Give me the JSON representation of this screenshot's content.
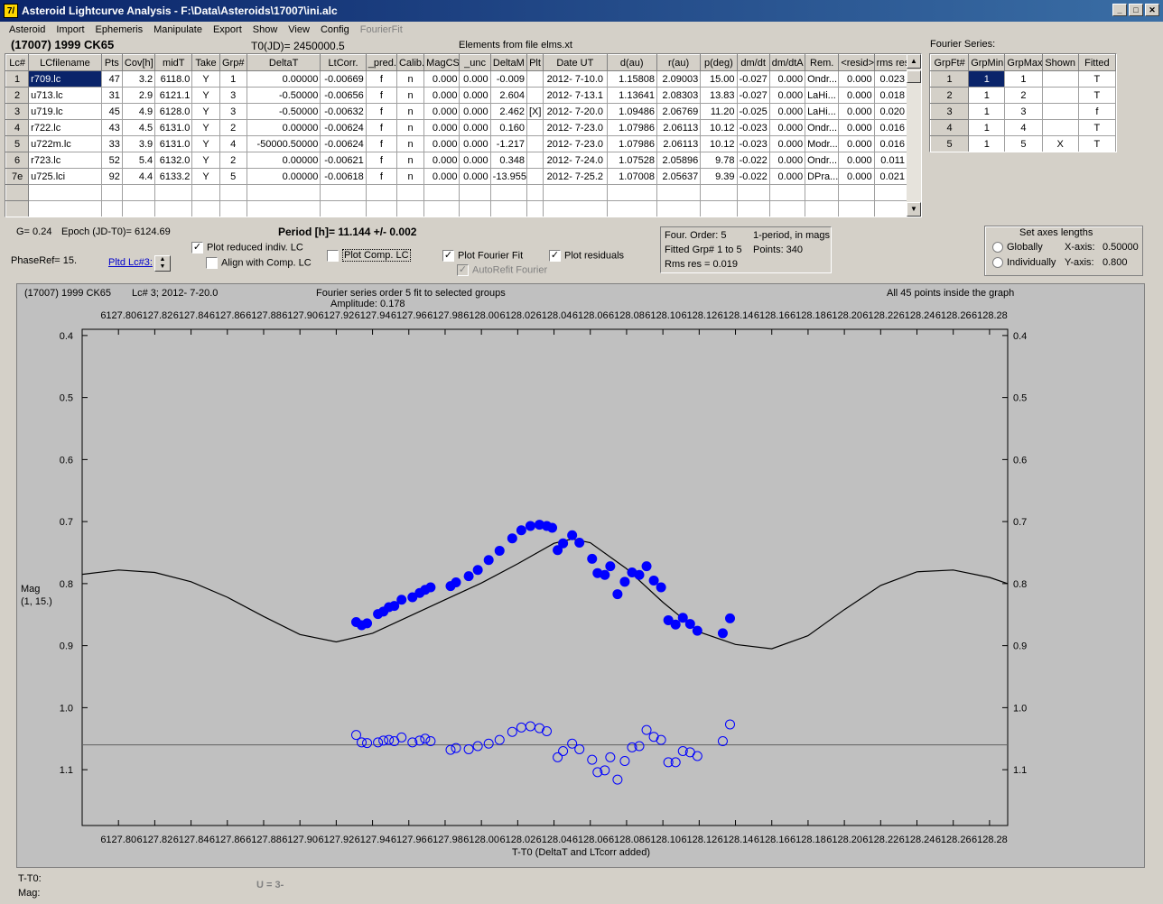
{
  "window": {
    "title": "Asteroid Lightcurve Analysis - F:\\Data\\Asteroids\\17007\\ini.alc",
    "icon_text": "7/"
  },
  "menu": [
    "Asteroid",
    "Import",
    "Ephemeris",
    "Manipulate",
    "Export",
    "Show",
    "View",
    "Config",
    "FourierFit"
  ],
  "header": {
    "asteroid": "(17007) 1999 CK65",
    "t0": "T0(JD)= 2450000.5",
    "elements": "Elements from file elms.xt"
  },
  "lc_table": {
    "columns": [
      "Lc#",
      "LCfilename",
      "Pts",
      "Cov[h]",
      "midT",
      "Take",
      "Grp#",
      "DeltaT",
      "LtCorr.",
      "_pred.",
      "Calib.",
      "MagCS",
      "_unc",
      "DeltaM",
      "Plt",
      "Date UT",
      "d(au)",
      "r(au)",
      "p(deg)",
      "dm/dt",
      "dm/dtA",
      "Rem.",
      "<resid>",
      "rms res"
    ],
    "rows": [
      [
        "1",
        "r709.lc",
        "47",
        "3.2",
        "6118.0",
        "Y",
        "1",
        "0.00000",
        "-0.00669",
        "f",
        "n",
        "0.000",
        "0.000",
        "-0.009",
        "",
        "2012- 7-10.0",
        "1.15808",
        "2.09003",
        "15.00",
        "-0.027",
        "0.000",
        "Ondr...",
        "0.000",
        "0.023"
      ],
      [
        "2",
        "u713.lc",
        "31",
        "2.9",
        "6121.1",
        "Y",
        "3",
        "-0.50000",
        "-0.00656",
        "f",
        "n",
        "0.000",
        "0.000",
        "2.604",
        "",
        "2012- 7-13.1",
        "1.13641",
        "2.08303",
        "13.83",
        "-0.027",
        "0.000",
        "LaHi...",
        "0.000",
        "0.018"
      ],
      [
        "3",
        "u719.lc",
        "45",
        "4.9",
        "6128.0",
        "Y",
        "3",
        "-0.50000",
        "-0.00632",
        "f",
        "n",
        "0.000",
        "0.000",
        "2.462",
        "[X]",
        "2012- 7-20.0",
        "1.09486",
        "2.06769",
        "11.20",
        "-0.025",
        "0.000",
        "LaHi...",
        "0.000",
        "0.020"
      ],
      [
        "4",
        "r722.lc",
        "43",
        "4.5",
        "6131.0",
        "Y",
        "2",
        "0.00000",
        "-0.00624",
        "f",
        "n",
        "0.000",
        "0.000",
        "0.160",
        "",
        "2012- 7-23.0",
        "1.07986",
        "2.06113",
        "10.12",
        "-0.023",
        "0.000",
        "Ondr...",
        "0.000",
        "0.016"
      ],
      [
        "5",
        "u722m.lc",
        "33",
        "3.9",
        "6131.0",
        "Y",
        "4",
        "-50000.50000",
        "-0.00624",
        "f",
        "n",
        "0.000",
        "0.000",
        "-1.217",
        "",
        "2012- 7-23.0",
        "1.07986",
        "2.06113",
        "10.12",
        "-0.023",
        "0.000",
        "Modr...",
        "0.000",
        "0.016"
      ],
      [
        "6",
        "r723.lc",
        "52",
        "5.4",
        "6132.0",
        "Y",
        "2",
        "0.00000",
        "-0.00621",
        "f",
        "n",
        "0.000",
        "0.000",
        "0.348",
        "",
        "2012- 7-24.0",
        "1.07528",
        "2.05896",
        "9.78",
        "-0.022",
        "0.000",
        "Ondr...",
        "0.000",
        "0.011"
      ],
      [
        "7e",
        "u725.lci",
        "92",
        "4.4",
        "6133.2",
        "Y",
        "5",
        "0.00000",
        "-0.00618",
        "f",
        "n",
        "0.000",
        "0.000",
        "-13.955",
        "",
        "2012- 7-25.2",
        "1.07008",
        "2.05637",
        "9.39",
        "-0.022",
        "0.000",
        "DPra...",
        "0.000",
        "0.021"
      ]
    ]
  },
  "fourier": {
    "title": "Fourier Series:",
    "columns": [
      "GrpFt#",
      "GrpMin",
      "GrpMax",
      "Shown",
      "Fitted"
    ],
    "rows": [
      [
        "1",
        "1",
        "1",
        "",
        "T"
      ],
      [
        "2",
        "1",
        "2",
        "",
        "T"
      ],
      [
        "3",
        "1",
        "3",
        "",
        "f"
      ],
      [
        "4",
        "1",
        "4",
        "",
        "T"
      ],
      [
        "5",
        "1",
        "5",
        "X",
        "T"
      ]
    ]
  },
  "controls": {
    "g": "G= 0.24",
    "epoch": "Epoch (JD-T0)= 6124.69",
    "period": "Period [h]= 11.144 +/- 0.002",
    "phaseref": "PhaseRef= 15.",
    "pltd_lc": "Pltd Lc#3:",
    "plot_reduced": "Plot reduced indiv. LC",
    "align_comp": "Align with Comp. LC",
    "plot_comp": "Plot Comp. LC",
    "plot_fourier": "Plot Fourier Fit",
    "plot_residuals": "Plot residuals",
    "autorefit": "AutoRefit Fourier",
    "four_order": "Four. Order:  5",
    "one_period": "1-period, in mags",
    "fitted_grp": "Fitted Grp# 1 to 5",
    "points": "Points: 340",
    "rms": "Rms res      = 0.019",
    "axes_title": "Set axes lengths",
    "globally": "Globally",
    "individually": "Individually",
    "xaxis_label": "X-axis:",
    "xaxis_val": "0.50000",
    "yaxis_label": "Y-axis:",
    "yaxis_val": "0.800"
  },
  "plot_header": {
    "left": "(17007) 1999 CK65",
    "lc": "Lc# 3; 2012- 7-20.0",
    "fit": "Fourier series order 5 fit to selected groups",
    "amplitude": "Amplitude: 0.178",
    "right": "All 45 points inside the graph"
  },
  "status": {
    "t_t0": "T-T0:",
    "mag": "Mag:",
    "u": "U = 3-"
  },
  "chart_data": {
    "type": "scatter",
    "xlabel": "T-T0 (DeltaT and LTcorr added)",
    "ylabel": "Mag",
    "ylabel2": "(1, 15.)",
    "xlim": [
      6127.78,
      6128.29
    ],
    "ylim": [
      0.39,
      1.19
    ],
    "y_reversed": true,
    "x_ticks": [
      "6127.80",
      "6127.82",
      "6127.84",
      "6127.86",
      "6127.88",
      "6127.90",
      "6127.92",
      "6127.94",
      "6127.96",
      "6127.98",
      "6128.00",
      "6128.02",
      "6128.04",
      "6128.06",
      "6128.08",
      "6128.10",
      "6128.12",
      "6128.14",
      "6128.16",
      "6128.18",
      "6128.20",
      "6128.22",
      "6128.24",
      "6128.26",
      "6128.28"
    ],
    "y_ticks": [
      "0.4",
      "0.5",
      "0.6",
      "0.7",
      "0.8",
      "0.9",
      "1.0",
      "1.1"
    ],
    "residual_baseline": 1.06,
    "fit_curve": [
      [
        6127.78,
        0.785
      ],
      [
        6127.8,
        0.778
      ],
      [
        6127.82,
        0.782
      ],
      [
        6127.84,
        0.797
      ],
      [
        6127.86,
        0.822
      ],
      [
        6127.88,
        0.853
      ],
      [
        6127.9,
        0.882
      ],
      [
        6127.92,
        0.894
      ],
      [
        6127.94,
        0.88
      ],
      [
        6127.96,
        0.853
      ],
      [
        6127.98,
        0.826
      ],
      [
        6128.0,
        0.799
      ],
      [
        6128.02,
        0.768
      ],
      [
        6128.04,
        0.735
      ],
      [
        6128.05,
        0.728
      ],
      [
        6128.06,
        0.734
      ],
      [
        6128.08,
        0.776
      ],
      [
        6128.1,
        0.83
      ],
      [
        6128.12,
        0.878
      ],
      [
        6128.14,
        0.898
      ],
      [
        6128.16,
        0.905
      ],
      [
        6128.18,
        0.884
      ],
      [
        6128.2,
        0.842
      ],
      [
        6128.22,
        0.803
      ],
      [
        6128.24,
        0.781
      ],
      [
        6128.26,
        0.778
      ],
      [
        6128.28,
        0.79
      ],
      [
        6128.29,
        0.8
      ]
    ],
    "points": [
      [
        6127.931,
        0.862
      ],
      [
        6127.934,
        0.867
      ],
      [
        6127.937,
        0.864
      ],
      [
        6127.943,
        0.849
      ],
      [
        6127.946,
        0.845
      ],
      [
        6127.949,
        0.838
      ],
      [
        6127.952,
        0.836
      ],
      [
        6127.956,
        0.826
      ],
      [
        6127.962,
        0.822
      ],
      [
        6127.966,
        0.815
      ],
      [
        6127.969,
        0.81
      ],
      [
        6127.972,
        0.806
      ],
      [
        6127.983,
        0.804
      ],
      [
        6127.986,
        0.798
      ],
      [
        6127.993,
        0.788
      ],
      [
        6127.998,
        0.778
      ],
      [
        6128.004,
        0.762
      ],
      [
        6128.01,
        0.747
      ],
      [
        6128.017,
        0.727
      ],
      [
        6128.022,
        0.714
      ],
      [
        6128.027,
        0.707
      ],
      [
        6128.032,
        0.705
      ],
      [
        6128.036,
        0.707
      ],
      [
        6128.039,
        0.71
      ],
      [
        6128.042,
        0.746
      ],
      [
        6128.045,
        0.735
      ],
      [
        6128.05,
        0.722
      ],
      [
        6128.054,
        0.734
      ],
      [
        6128.061,
        0.76
      ],
      [
        6128.064,
        0.783
      ],
      [
        6128.068,
        0.786
      ],
      [
        6128.071,
        0.772
      ],
      [
        6128.075,
        0.817
      ],
      [
        6128.079,
        0.797
      ],
      [
        6128.083,
        0.782
      ],
      [
        6128.087,
        0.786
      ],
      [
        6128.091,
        0.772
      ],
      [
        6128.095,
        0.795
      ],
      [
        6128.099,
        0.806
      ],
      [
        6128.103,
        0.859
      ],
      [
        6128.107,
        0.866
      ],
      [
        6128.111,
        0.855
      ],
      [
        6128.115,
        0.865
      ],
      [
        6128.119,
        0.876
      ],
      [
        6128.133,
        0.88
      ],
      [
        6128.137,
        0.856
      ]
    ],
    "residuals": [
      [
        6127.931,
        1.044
      ],
      [
        6127.934,
        1.056
      ],
      [
        6127.937,
        1.057
      ],
      [
        6127.943,
        1.056
      ],
      [
        6127.946,
        1.053
      ],
      [
        6127.949,
        1.052
      ],
      [
        6127.952,
        1.054
      ],
      [
        6127.956,
        1.048
      ],
      [
        6127.962,
        1.056
      ],
      [
        6127.966,
        1.053
      ],
      [
        6127.969,
        1.05
      ],
      [
        6127.972,
        1.054
      ],
      [
        6127.983,
        1.068
      ],
      [
        6127.986,
        1.065
      ],
      [
        6127.993,
        1.067
      ],
      [
        6127.998,
        1.062
      ],
      [
        6128.004,
        1.058
      ],
      [
        6128.01,
        1.052
      ],
      [
        6128.017,
        1.039
      ],
      [
        6128.022,
        1.032
      ],
      [
        6128.027,
        1.03
      ],
      [
        6128.032,
        1.033
      ],
      [
        6128.036,
        1.038
      ],
      [
        6128.042,
        1.08
      ],
      [
        6128.045,
        1.07
      ],
      [
        6128.05,
        1.058
      ],
      [
        6128.054,
        1.067
      ],
      [
        6128.061,
        1.084
      ],
      [
        6128.064,
        1.104
      ],
      [
        6128.068,
        1.101
      ],
      [
        6128.071,
        1.08
      ],
      [
        6128.075,
        1.116
      ],
      [
        6128.079,
        1.086
      ],
      [
        6128.083,
        1.064
      ],
      [
        6128.087,
        1.062
      ],
      [
        6128.091,
        1.036
      ],
      [
        6128.095,
        1.047
      ],
      [
        6128.099,
        1.052
      ],
      [
        6128.103,
        1.088
      ],
      [
        6128.107,
        1.088
      ],
      [
        6128.111,
        1.07
      ],
      [
        6128.115,
        1.072
      ],
      [
        6128.119,
        1.078
      ],
      [
        6128.133,
        1.054
      ],
      [
        6128.137,
        1.027
      ]
    ]
  },
  "colors": {
    "title_bar": "#0a246a",
    "points": "#0000ff",
    "plot_bg": "#c0c0c0"
  }
}
